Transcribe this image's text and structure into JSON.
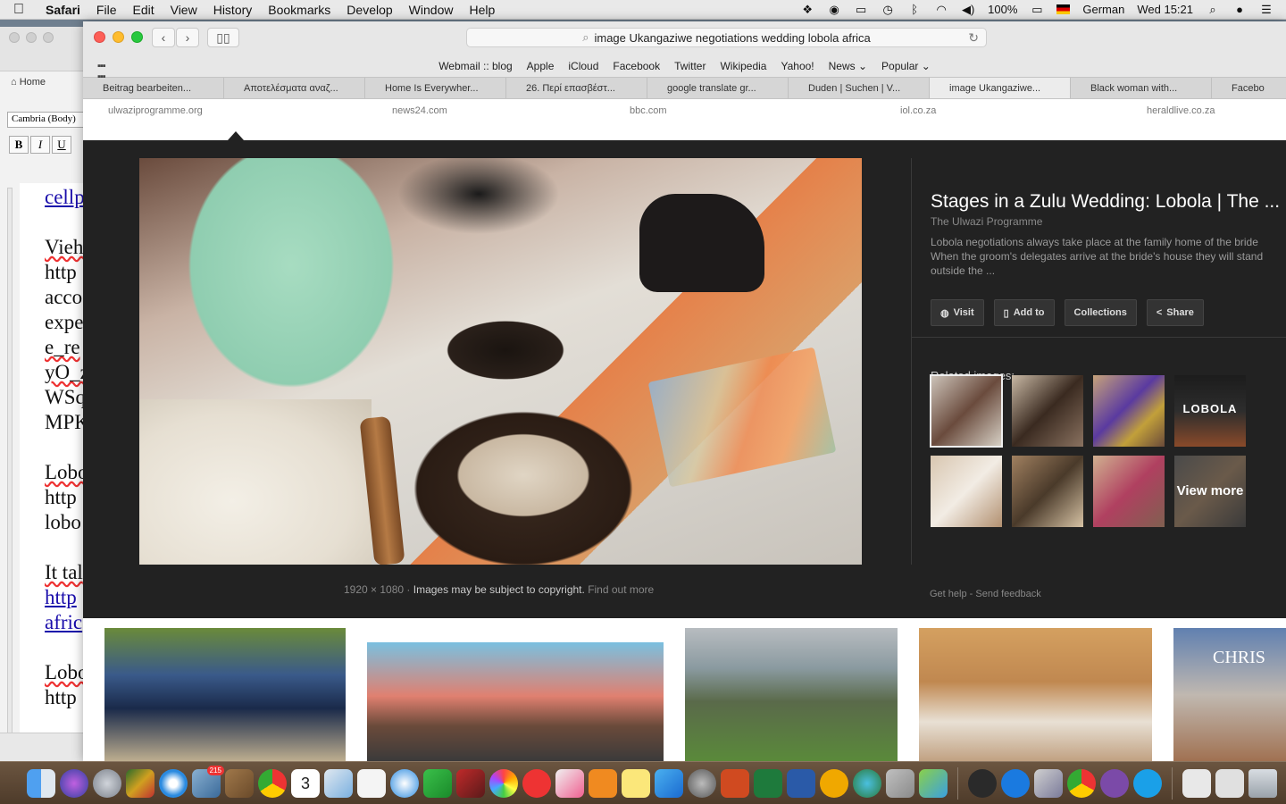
{
  "menubar": {
    "app": "Safari",
    "items": [
      "File",
      "Edit",
      "View",
      "History",
      "Bookmarks",
      "Develop",
      "Window",
      "Help"
    ],
    "battery": "100%",
    "language": "German",
    "clock": "Wed 15:21"
  },
  "word": {
    "home_tab": "Home",
    "font": "Cambria (Body)",
    "bold": "B",
    "italic": "I",
    "underline": "U",
    "lines": [
      "cellp",
      "",
      "Vieh",
      "http",
      "acco",
      "expe",
      "e_re",
      "yO_z",
      "WSq",
      "MPK",
      "",
      "Lobo",
      "http",
      "lobo",
      "",
      "It tal",
      "http",
      "afric",
      "",
      "Lobo",
      "http"
    ]
  },
  "safari": {
    "address": "image Ukangaziwe negotiations wedding lobola africa",
    "favorites": [
      "Webmail :: blog",
      "Apple",
      "iCloud",
      "Facebook",
      "Twitter",
      "Wikipedia",
      "Yahoo!",
      "News ⌄",
      "Popular ⌄"
    ],
    "tabs": [
      {
        "label": "Beitrag bearbeiten..."
      },
      {
        "label": "Αποτελέσματα αναζ..."
      },
      {
        "label": "Home Is Everywher..."
      },
      {
        "label": "26. Περί επασβέστ..."
      },
      {
        "label": "google translate gr..."
      },
      {
        "label": "Duden | Suchen | V..."
      },
      {
        "label": "image Ukangaziwe..."
      },
      {
        "label": "Black woman with..."
      },
      {
        "label": "Facebo"
      }
    ]
  },
  "page": {
    "sources": [
      "ulwaziprogramme.org",
      "news24.com",
      "bbc.com",
      "iol.co.za",
      "heraldlive.co.za"
    ],
    "viewer": {
      "dimensions": "1920 × 1080",
      "copyright": "Images may be subject to copyright.",
      "find_out_more": "Find out more",
      "title": "Stages in a Zulu Wedding: Lobola | The ...",
      "site": "The Ulwazi Programme",
      "description_lines": [
        "Lobola negotiations always take place at the family home of the bride",
        "When the groom's delegates arrive at the bride's house they will stand",
        "outside the ..."
      ],
      "buttons": {
        "visit": "Visit",
        "add_to": "Add to",
        "collections": "Collections",
        "share": "Share"
      },
      "related_label": "Related images:",
      "thumb_lobola_text": "LOBOLA",
      "view_more": "View more",
      "get_help": "Get help",
      "send_feedback": "Send feedback"
    },
    "results_text": "CHRIS"
  },
  "dock": {
    "badge_mail": "215",
    "calendar_day": "3"
  }
}
